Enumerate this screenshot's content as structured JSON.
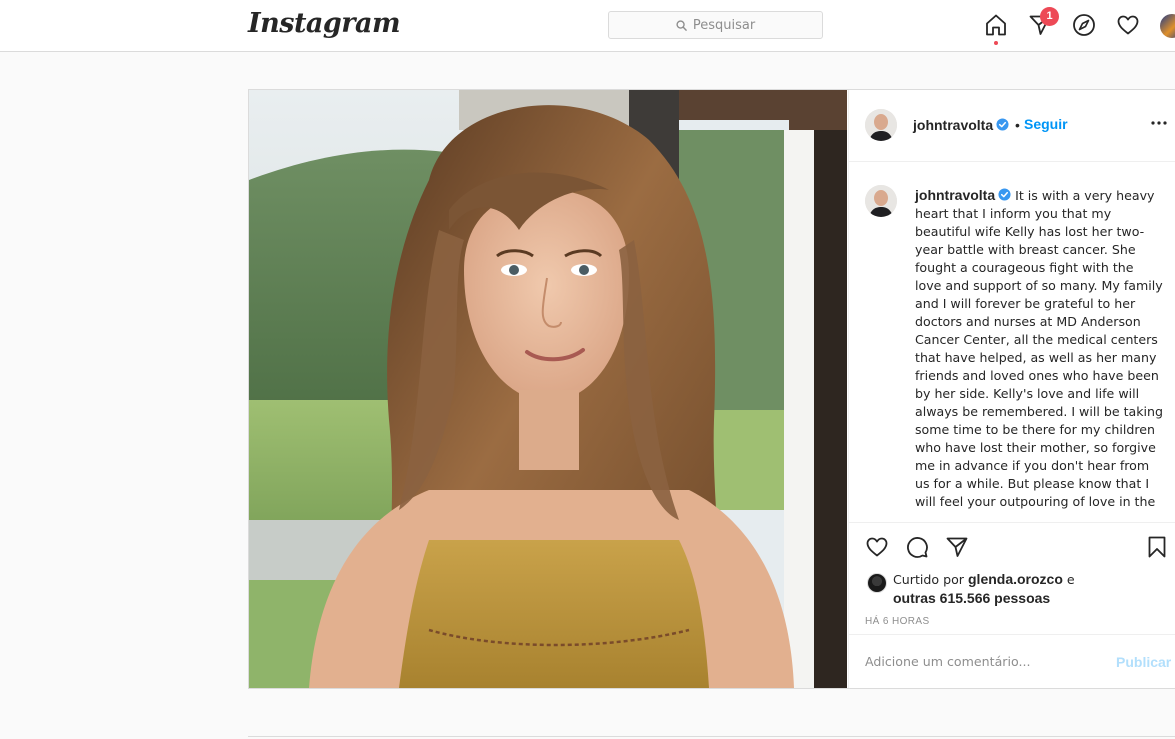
{
  "header": {
    "logo": "Instagram",
    "search_placeholder": "Pesquisar",
    "direct_badge": "1"
  },
  "post": {
    "image_alt": "Foto de uma mulher de cabelos longos castanho-claros sorrindo",
    "author": "johntravolta",
    "separator": "•",
    "follow_label": "Seguir",
    "caption": "It is with a very heavy heart that I inform you that my beautiful wife Kelly has lost her two-year battle with breast cancer. She fought a courageous fight with the love and support of so many.  My family and I will forever be grateful to her doctors and nurses at MD Anderson Cancer Center, all the medical centers that have helped, as well as her many friends and loved ones who have been by her side. Kelly's love and life will always be remembered. I will be taking some time to be there for my children who have lost their mother, so forgive me in advance if you don't hear from us for a while.  But please know that I will feel your outpouring of love in the",
    "liked_prefix": "Curtido por",
    "liked_user": "glenda.orozco",
    "liked_conj": "e",
    "liked_others": "outras 615.566 pessoas",
    "time_ago": "HÁ 6 HORAS",
    "comment_placeholder": "Adicione um comentário...",
    "publish_label": "Publicar"
  },
  "icons": {
    "search": "search-icon",
    "home": "home-icon",
    "direct": "direct-icon",
    "explore": "compass-icon",
    "activity": "heart-icon",
    "like": "heart-icon",
    "comment": "comment-icon",
    "share": "share-icon",
    "save": "bookmark-icon",
    "more": "more-icon",
    "verified": "verified-badge-icon"
  },
  "colors": {
    "accent": "#0095f6",
    "badge": "#ed4956",
    "publish_disabled": "#b2dffc",
    "verified": "#3897f0"
  }
}
